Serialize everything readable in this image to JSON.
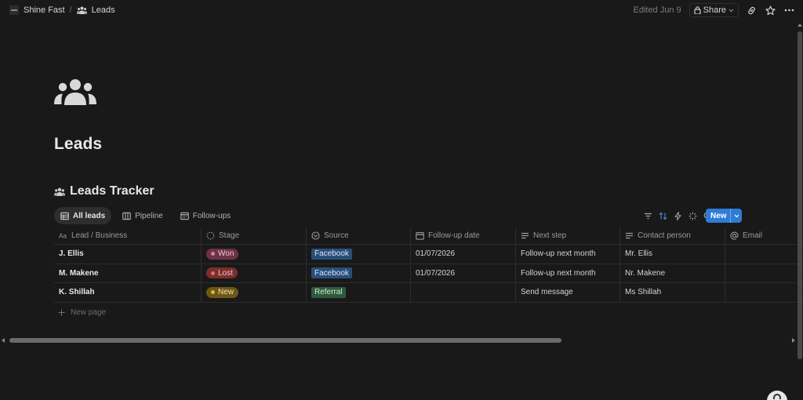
{
  "breadcrumb": {
    "workspace": "Shine Fast",
    "separator": "/",
    "page": "Leads"
  },
  "topbar": {
    "edited": "Edited Jun 9",
    "share": "Share"
  },
  "page": {
    "title": "Leads"
  },
  "database": {
    "title": "Leads Tracker",
    "views": [
      {
        "label": "All leads",
        "icon": "table-icon",
        "active": true
      },
      {
        "label": "Pipeline",
        "icon": "board-icon",
        "active": false
      },
      {
        "label": "Follow-ups",
        "icon": "calendar-icon",
        "active": false
      }
    ],
    "new_label": "New",
    "columns": [
      {
        "label": "Lead / Business",
        "icon": "title-icon"
      },
      {
        "label": "Stage",
        "icon": "status-icon"
      },
      {
        "label": "Source",
        "icon": "select-icon"
      },
      {
        "label": "Follow-up date",
        "icon": "date-icon"
      },
      {
        "label": "Next step",
        "icon": "text-icon"
      },
      {
        "label": "Contact person",
        "icon": "text-icon"
      },
      {
        "label": "Email",
        "icon": "at-icon"
      }
    ],
    "rows": [
      {
        "name": "J. Ellis",
        "stage": "Won",
        "source": "Facebook",
        "follow_up": "01/07/2026",
        "next_step": "Follow-up next month",
        "contact": "Mr. Ellis",
        "email": ""
      },
      {
        "name": "M. Makene",
        "stage": "Lost",
        "source": "Facebook",
        "follow_up": "01/07/2026",
        "next_step": "Follow-up next month",
        "contact": "Nr. Makene",
        "email": ""
      },
      {
        "name": "K. Shillah",
        "stage": "New",
        "source": "Referral",
        "follow_up": "",
        "next_step": "Send message",
        "contact": "Ms Shillah",
        "email": ""
      }
    ],
    "new_page": "New page"
  },
  "colors": {
    "background": "#191919",
    "accent": "#2e7cd6",
    "stage_won_bg": "#6b3347",
    "stage_won_dot": "#e07a9c",
    "stage_lost_bg": "#7a2f2c",
    "stage_lost_dot": "#e26a62",
    "stage_new_bg": "#6d5716",
    "stage_new_dot": "#e3b23a",
    "source_facebook_bg": "#2a4e7a",
    "source_referral_bg": "#2e5a3c"
  }
}
